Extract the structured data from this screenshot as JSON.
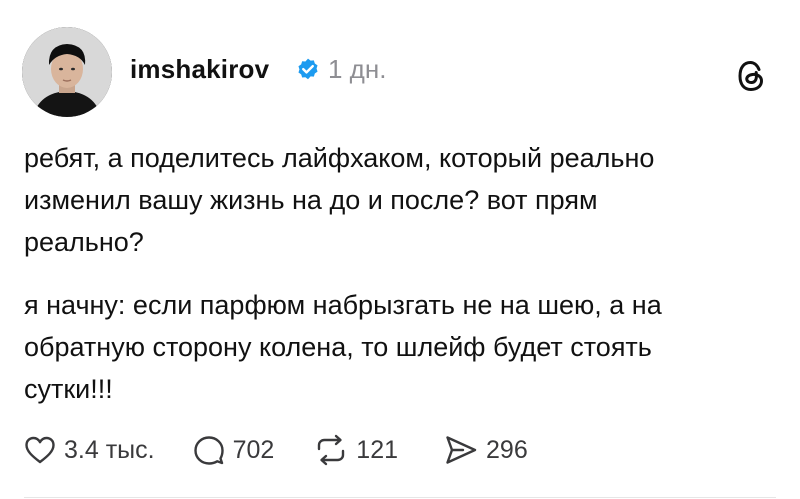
{
  "post": {
    "username": "imshakirov",
    "time": "1 дн.",
    "paragraphs": [
      "ребят, а поделитесь лайфхаком, который реально\nизменил вашу жизнь на до и после? вот прям\nреально?",
      "я начну: если парфюм набрызгать не на шею, а на\nобратную сторону колена, то шлейф будет стоять\nсутки!!!"
    ],
    "actions": {
      "likes": "3.4 тыс.",
      "replies": "702",
      "reposts": "121",
      "shares": "296"
    }
  },
  "icons": {
    "verified": "verified-badge-icon",
    "app": "threads-logo-icon",
    "like": "heart-icon",
    "reply": "comment-bubble-icon",
    "repost": "repost-icon",
    "share": "send-icon"
  },
  "colors": {
    "verified_blue": "#1d9bf0",
    "muted_text": "#8e8e93",
    "icon_gray": "#3a3a3c"
  }
}
